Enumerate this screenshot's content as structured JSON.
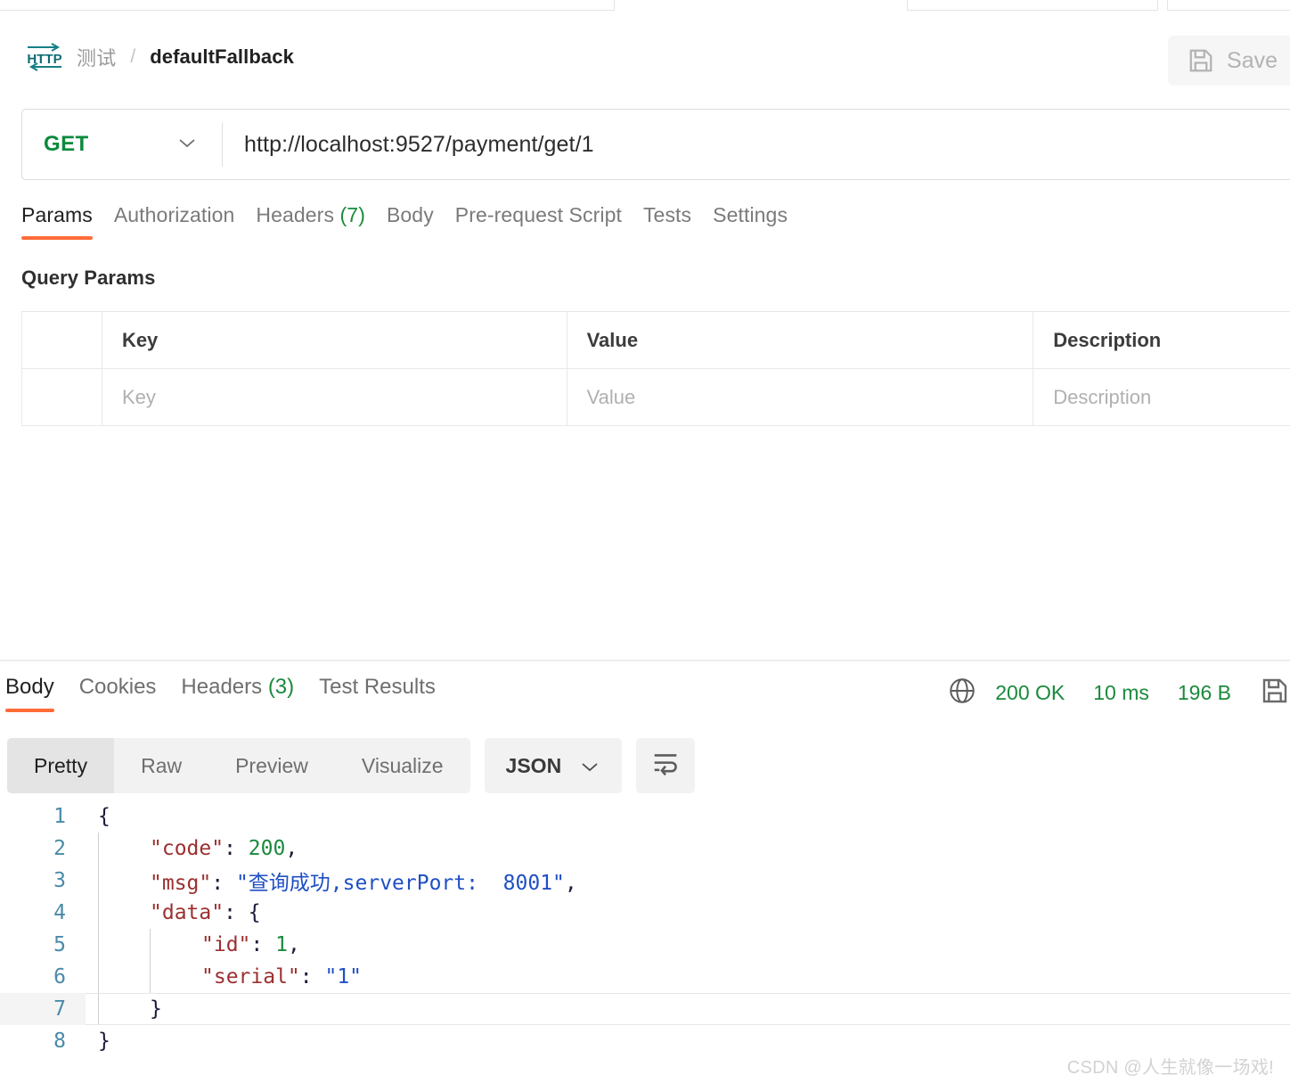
{
  "header": {
    "protocol_icon": "http-icon",
    "breadcrumb_folder": "测试",
    "breadcrumb_separator": "/",
    "breadcrumb_name": "defaultFallback",
    "save_label": "Save",
    "save_icon": "floppy-disk-icon"
  },
  "url_bar": {
    "method": "GET",
    "method_chevron_icon": "chevron-down-icon",
    "url": "http://localhost:9527/payment/get/1",
    "method_color": "#0b8a3c"
  },
  "request_tabs": [
    {
      "label": "Params",
      "count": "",
      "active": true
    },
    {
      "label": "Authorization",
      "count": "",
      "active": false
    },
    {
      "label": "Headers",
      "count": "(7)",
      "active": false
    },
    {
      "label": "Body",
      "count": "",
      "active": false
    },
    {
      "label": "Pre-request Script",
      "count": "",
      "active": false
    },
    {
      "label": "Tests",
      "count": "",
      "active": false
    },
    {
      "label": "Settings",
      "count": "",
      "active": false
    }
  ],
  "query_params": {
    "title": "Query Params",
    "columns": [
      "Key",
      "Value",
      "Description"
    ],
    "rows": [
      {
        "key": "Key",
        "value": "Value",
        "description": "Description"
      }
    ]
  },
  "response": {
    "tabs": [
      {
        "label": "Body",
        "count": "",
        "active": true
      },
      {
        "label": "Cookies",
        "count": "",
        "active": false
      },
      {
        "label": "Headers",
        "count": "(3)",
        "active": false
      },
      {
        "label": "Test Results",
        "count": "",
        "active": false
      }
    ],
    "globe_icon": "globe-icon",
    "status": "200 OK",
    "time": "10 ms",
    "size": "196 B",
    "save_response_icon": "save-response-icon",
    "status_color": "#1a8a3c",
    "format_tabs": [
      {
        "label": "Pretty",
        "active": true
      },
      {
        "label": "Raw",
        "active": false
      },
      {
        "label": "Preview",
        "active": false
      },
      {
        "label": "Visualize",
        "active": false
      }
    ],
    "content_type": "JSON",
    "content_type_chevron_icon": "chevron-down-icon",
    "wrap_lines_icon": "wrap-lines-icon"
  },
  "json_body": {
    "lines": [
      {
        "n": "1",
        "indent": 0,
        "highlight": false,
        "tokens": [
          {
            "t": "{",
            "c": "brace"
          }
        ]
      },
      {
        "n": "2",
        "indent": 1,
        "highlight": false,
        "tokens": [
          {
            "t": "\"code\"",
            "c": "key"
          },
          {
            "t": ": ",
            "c": "punc"
          },
          {
            "t": "200",
            "c": "num"
          },
          {
            "t": ",",
            "c": "punc"
          }
        ]
      },
      {
        "n": "3",
        "indent": 1,
        "highlight": false,
        "tokens": [
          {
            "t": "\"msg\"",
            "c": "key"
          },
          {
            "t": ": ",
            "c": "punc"
          },
          {
            "t": "\"查询成功,serverPort:  8001\"",
            "c": "str"
          },
          {
            "t": ",",
            "c": "punc"
          }
        ]
      },
      {
        "n": "4",
        "indent": 1,
        "highlight": false,
        "tokens": [
          {
            "t": "\"data\"",
            "c": "key"
          },
          {
            "t": ": ",
            "c": "punc"
          },
          {
            "t": "{",
            "c": "brace"
          }
        ]
      },
      {
        "n": "5",
        "indent": 2,
        "highlight": false,
        "tokens": [
          {
            "t": "\"id\"",
            "c": "key"
          },
          {
            "t": ": ",
            "c": "punc"
          },
          {
            "t": "1",
            "c": "num"
          },
          {
            "t": ",",
            "c": "punc"
          }
        ]
      },
      {
        "n": "6",
        "indent": 2,
        "highlight": false,
        "tokens": [
          {
            "t": "\"serial\"",
            "c": "key"
          },
          {
            "t": ": ",
            "c": "punc"
          },
          {
            "t": "\"1\"",
            "c": "str"
          }
        ]
      },
      {
        "n": "7",
        "indent": 1,
        "highlight": true,
        "tokens": [
          {
            "t": "}",
            "c": "brace"
          }
        ]
      },
      {
        "n": "8",
        "indent": 0,
        "highlight": false,
        "tokens": [
          {
            "t": "}",
            "c": "brace"
          }
        ]
      }
    ],
    "raw": "{\n    \"code\": 200,\n    \"msg\": \"查询成功,serverPort:  8001\",\n    \"data\": {\n        \"id\": 1,\n        \"serial\": \"1\"\n    }\n}",
    "values": {
      "code": 200,
      "msg": "查询成功,serverPort:  8001",
      "data": {
        "id": 1,
        "serial": "1"
      }
    }
  },
  "watermark": "CSDN @人生就像一场戏!"
}
